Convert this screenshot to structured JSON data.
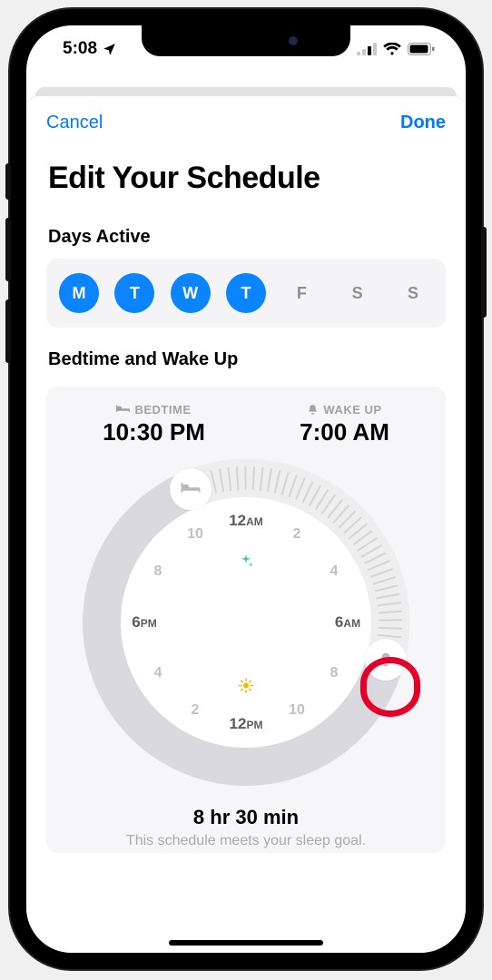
{
  "status": {
    "time": "5:08"
  },
  "nav": {
    "cancel": "Cancel",
    "done": "Done"
  },
  "title": "Edit Your Schedule",
  "days": {
    "label": "Days Active",
    "items": [
      {
        "label": "M",
        "active": true
      },
      {
        "label": "T",
        "active": true
      },
      {
        "label": "W",
        "active": true
      },
      {
        "label": "T",
        "active": true
      },
      {
        "label": "F",
        "active": false
      },
      {
        "label": "S",
        "active": false
      },
      {
        "label": "S",
        "active": false
      }
    ]
  },
  "schedule": {
    "section_label": "Bedtime and Wake Up",
    "bedtime": {
      "label": "BEDTIME",
      "value": "10:30 PM"
    },
    "wakeup": {
      "label": "WAKE UP",
      "value": "7:00 AM"
    },
    "duration": "8 hr 30 min",
    "goal_text": "This schedule meets your sleep goal."
  },
  "clock": {
    "ticks": [
      {
        "label": "12",
        "ampm": "AM",
        "major": true,
        "angle": 0
      },
      {
        "label": "2",
        "major": false,
        "angle": 30
      },
      {
        "label": "4",
        "major": false,
        "angle": 60
      },
      {
        "label": "6",
        "ampm": "AM",
        "major": true,
        "angle": 90
      },
      {
        "label": "8",
        "major": false,
        "angle": 120
      },
      {
        "label": "10",
        "major": false,
        "angle": 150
      },
      {
        "label": "12",
        "ampm": "PM",
        "major": true,
        "angle": 180
      },
      {
        "label": "2",
        "major": false,
        "angle": 210
      },
      {
        "label": "4",
        "major": false,
        "angle": 240
      },
      {
        "label": "6",
        "ampm": "PM",
        "major": true,
        "angle": 270
      },
      {
        "label": "8",
        "major": false,
        "angle": 300
      },
      {
        "label": "10",
        "major": false,
        "angle": 330
      }
    ],
    "start_angle": 337.5,
    "end_angle": 105
  },
  "colors": {
    "accent": "#0a84ff",
    "ring": "#d9d9de",
    "arc": "#eeeeef"
  }
}
